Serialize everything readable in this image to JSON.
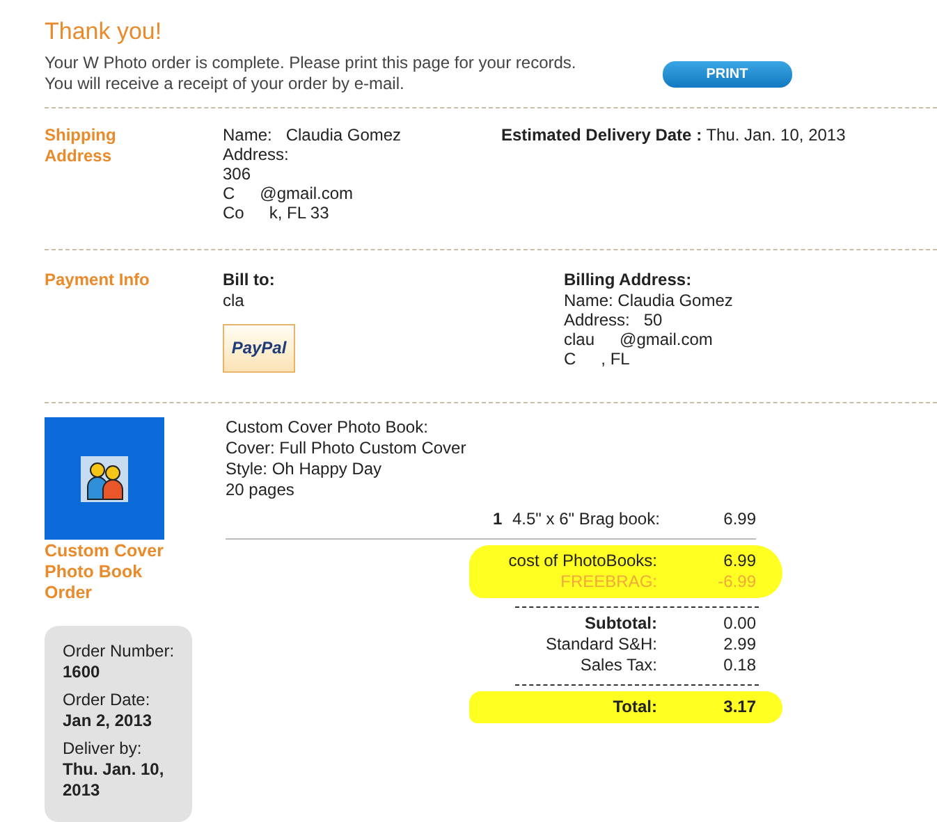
{
  "header": {
    "title": "Thank you!",
    "message_lines": [
      "Your W Photo order is complete. Please print this page for your records.",
      "You will receive a receipt of your order by e-mail."
    ],
    "print_button": "PRINT"
  },
  "shipping": {
    "label_lines": [
      "Shipping",
      "Address"
    ],
    "lines": [
      [
        "Name:   Claudia Gomez"
      ],
      [
        "Address:"
      ],
      [
        "306"
      ],
      [
        "C",
        "@gmail.com"
      ],
      [
        "Co",
        "k, FL 33"
      ]
    ],
    "delivery_label": "Estimated Delivery Date :",
    "delivery_value": "Thu. Jan. 10, 2013"
  },
  "payment": {
    "label": "Payment Info",
    "bill_to_label": "Bill to:",
    "bill_to_value": "cla",
    "logo": "PayPal",
    "billing_label": "Billing Address:",
    "billing_lines": [
      [
        "Name: Claudia Gomez"
      ],
      [
        "Address:   50"
      ],
      [
        "clau",
        "@gmail.com"
      ],
      [
        "C",
        ", FL"
      ]
    ]
  },
  "order": {
    "product_label_lines": [
      "Custom Cover",
      "Photo Book",
      "Order"
    ],
    "info": [
      {
        "label": "Order Number:",
        "value": "1600"
      },
      {
        "label": "Order Date:",
        "value": "Jan 2, 2013"
      },
      {
        "label": "Deliver by:",
        "value": "Thu. Jan. 10, 2013"
      }
    ],
    "details": [
      "Custom Cover Photo Book:",
      "Cover: Full Photo Custom Cover",
      "Style: Oh Happy Day",
      "20 pages"
    ],
    "summary": [
      {
        "kind": "first",
        "highlighted": false,
        "rows": [
          {
            "kind": "item",
            "qty": "1",
            "label": "4.5\" x 6\" Brag book:",
            "value": "6.99"
          }
        ]
      },
      {
        "kind": "after-solid-rule",
        "highlighted": true,
        "rows": [
          {
            "kind": "plain",
            "label": "cost of PhotoBooks:",
            "value": "6.99"
          },
          {
            "kind": "discount",
            "label": "FREEBRAG:",
            "value": "-6.99"
          }
        ]
      },
      {
        "kind": "after-dotted-rule",
        "highlighted": false,
        "rows": [
          {
            "kind": "subtotal",
            "label": "Subtotal:",
            "value": "0.00"
          },
          {
            "kind": "plain",
            "label": "Standard S&H:",
            "value": "2.99"
          },
          {
            "kind": "plain",
            "label": "Sales Tax:",
            "value": "0.18"
          }
        ]
      },
      {
        "kind": "after-dotted-rule",
        "highlighted": true,
        "rows": [
          {
            "kind": "total",
            "label": "Total:",
            "value": "3.17"
          }
        ]
      }
    ]
  }
}
